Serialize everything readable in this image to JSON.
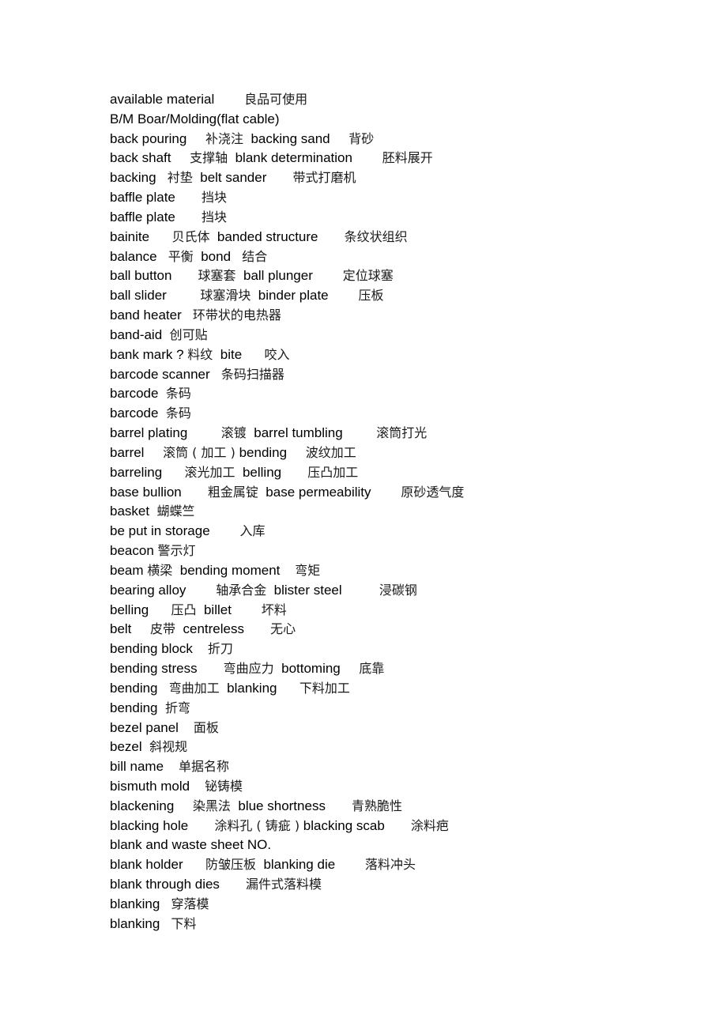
{
  "document": {
    "lines": [
      [
        {
          "en": "available material",
          "gap": "        "
        },
        {
          "zh": "良品可使用"
        }
      ],
      [
        {
          "en": "B/M Boar/Molding(flat cable)"
        }
      ],
      [
        {
          "en": "back pouring",
          "gap": "     "
        },
        {
          "zh": "补浇注",
          "gap": "  "
        },
        {
          "en": "backing sand",
          "gap": "     "
        },
        {
          "zh": "背砂"
        }
      ],
      [
        {
          "en": "back shaft",
          "gap": "     "
        },
        {
          "zh": "支撑轴",
          "gap": "  "
        },
        {
          "en": "blank determination",
          "gap": "        "
        },
        {
          "zh": "胚料展开"
        }
      ],
      [
        {
          "en": "backing",
          "gap": "   "
        },
        {
          "zh": "衬垫",
          "gap": "  "
        },
        {
          "en": "belt sander",
          "gap": "       "
        },
        {
          "zh": "带式打磨机"
        }
      ],
      [
        {
          "en": "baffle plate",
          "gap": "       "
        },
        {
          "zh": "挡块"
        }
      ],
      [
        {
          "en": "baffle plate",
          "gap": "       "
        },
        {
          "zh": "挡块"
        }
      ],
      [
        {
          "en": "bainite",
          "gap": "      "
        },
        {
          "zh": "贝氏体",
          "gap": "  "
        },
        {
          "en": "banded structure",
          "gap": "       "
        },
        {
          "zh": "条纹状组织"
        }
      ],
      [
        {
          "en": "balance",
          "gap": "   "
        },
        {
          "zh": "平衡",
          "gap": "  "
        },
        {
          "en": "bond",
          "gap": "   "
        },
        {
          "zh": "结合"
        }
      ],
      [
        {
          "en": "ball button",
          "gap": "       "
        },
        {
          "zh": "球塞套",
          "gap": "  "
        },
        {
          "en": "ball plunger",
          "gap": "        "
        },
        {
          "zh": "定位球塞"
        }
      ],
      [
        {
          "en": "ball slider",
          "gap": "         "
        },
        {
          "zh": "球塞滑块",
          "gap": "  "
        },
        {
          "en": "binder plate",
          "gap": "        "
        },
        {
          "zh": "压板"
        }
      ],
      [
        {
          "en": "band heater",
          "gap": "   "
        },
        {
          "zh": "环带状的电热器"
        }
      ],
      [
        {
          "en": "band-aid",
          "gap": "  "
        },
        {
          "zh": "创可贴"
        }
      ],
      [
        {
          "en": "bank mark ?",
          "gap": " "
        },
        {
          "zh": "料纹",
          "gap": "  "
        },
        {
          "en": "bite",
          "gap": "      "
        },
        {
          "zh": "咬入"
        }
      ],
      [
        {
          "en": "barcode scanner",
          "gap": "   "
        },
        {
          "zh": "条码扫描器"
        }
      ],
      [
        {
          "en": "barcode",
          "gap": "  "
        },
        {
          "zh": "条码"
        }
      ],
      [
        {
          "en": "barcode",
          "gap": "  "
        },
        {
          "zh": "条码"
        }
      ],
      [
        {
          "en": "barrel plating",
          "gap": "         "
        },
        {
          "zh": "滚镀",
          "gap": "  "
        },
        {
          "en": "barrel tumbling",
          "gap": "         "
        },
        {
          "zh": "滚筒打光"
        }
      ],
      [
        {
          "en": "barrel",
          "gap": "     "
        },
        {
          "zh": "滚筒 ( 加工 )",
          "gap": " "
        },
        {
          "en": "bending",
          "gap": "     "
        },
        {
          "zh": "波纹加工"
        }
      ],
      [
        {
          "en": "barreling",
          "gap": "      "
        },
        {
          "zh": "滚光加工",
          "gap": "  "
        },
        {
          "en": "belling",
          "gap": "       "
        },
        {
          "zh": "压凸加工"
        }
      ],
      [
        {
          "en": "base bullion",
          "gap": "       "
        },
        {
          "zh": "粗金属锭",
          "gap": "  "
        },
        {
          "en": "base permeability",
          "gap": "        "
        },
        {
          "zh": "原砂透气度"
        }
      ],
      [
        {
          "en": "basket",
          "gap": "  "
        },
        {
          "zh": "蝴蝶竺"
        }
      ],
      [
        {
          "en": "be put in storage",
          "gap": "        "
        },
        {
          "zh": "入库"
        }
      ],
      [
        {
          "en": "beacon",
          "gap": " "
        },
        {
          "zh": "警示灯"
        }
      ],
      [
        {
          "en": "beam",
          "gap": " "
        },
        {
          "zh": "横梁",
          "gap": "  "
        },
        {
          "en": "bending moment",
          "gap": "    "
        },
        {
          "zh": "弯矩"
        }
      ],
      [
        {
          "en": "bearing alloy",
          "gap": "        "
        },
        {
          "zh": "轴承合金",
          "gap": "  "
        },
        {
          "en": "blister steel",
          "gap": "          "
        },
        {
          "zh": "浸碳钢"
        }
      ],
      [
        {
          "en": "belling",
          "gap": "      "
        },
        {
          "zh": "压凸",
          "gap": "  "
        },
        {
          "en": "billet",
          "gap": "        "
        },
        {
          "zh": "坏料"
        }
      ],
      [
        {
          "en": "belt",
          "gap": "     "
        },
        {
          "zh": "皮带",
          "gap": "  "
        },
        {
          "en": "centreless",
          "gap": "       "
        },
        {
          "zh": "无心"
        }
      ],
      [
        {
          "en": "bending block",
          "gap": "    "
        },
        {
          "zh": "折刀"
        }
      ],
      [
        {
          "en": "bending stress",
          "gap": "       "
        },
        {
          "zh": "弯曲应力",
          "gap": "  "
        },
        {
          "en": "bottoming",
          "gap": "     "
        },
        {
          "zh": "底靠"
        }
      ],
      [
        {
          "en": "bending",
          "gap": "   "
        },
        {
          "zh": "弯曲加工",
          "gap": "  "
        },
        {
          "en": "blanking",
          "gap": "      "
        },
        {
          "zh": "下料加工"
        }
      ],
      [
        {
          "en": "bending",
          "gap": "  "
        },
        {
          "zh": "折弯"
        }
      ],
      [
        {
          "en": "bezel panel",
          "gap": "    "
        },
        {
          "zh": "面板"
        }
      ],
      [
        {
          "en": "bezel",
          "gap": "  "
        },
        {
          "zh": "斜视规"
        }
      ],
      [
        {
          "en": "bill name",
          "gap": "    "
        },
        {
          "zh": "单据名称"
        }
      ],
      [
        {
          "en": "bismuth mold",
          "gap": "    "
        },
        {
          "zh": "铋铸模"
        }
      ],
      [
        {
          "en": "blackening",
          "gap": "     "
        },
        {
          "zh": "染黑法",
          "gap": "  "
        },
        {
          "en": "blue shortness",
          "gap": "       "
        },
        {
          "zh": "青熟脆性"
        }
      ],
      [
        {
          "en": "blacking hole",
          "gap": "       "
        },
        {
          "zh": "涂料孔 ( 铸疵 )",
          "gap": " "
        },
        {
          "en": "blacking scab",
          "gap": "       "
        },
        {
          "zh": "涂料疤"
        }
      ],
      [
        {
          "en": "blank and waste sheet NO."
        }
      ],
      [
        {
          "en": "blank holder",
          "gap": "      "
        },
        {
          "zh": "防皱压板",
          "gap": "  "
        },
        {
          "en": "blanking die",
          "gap": "        "
        },
        {
          "zh": "落料冲头"
        }
      ],
      [
        {
          "en": "blank through dies",
          "gap": "       "
        },
        {
          "zh": "漏件式落料模"
        }
      ],
      [
        {
          "en": "blanking",
          "gap": "   "
        },
        {
          "zh": "穿落模"
        }
      ],
      [
        {
          "en": "blanking",
          "gap": "   "
        },
        {
          "zh": "下料"
        }
      ]
    ]
  }
}
